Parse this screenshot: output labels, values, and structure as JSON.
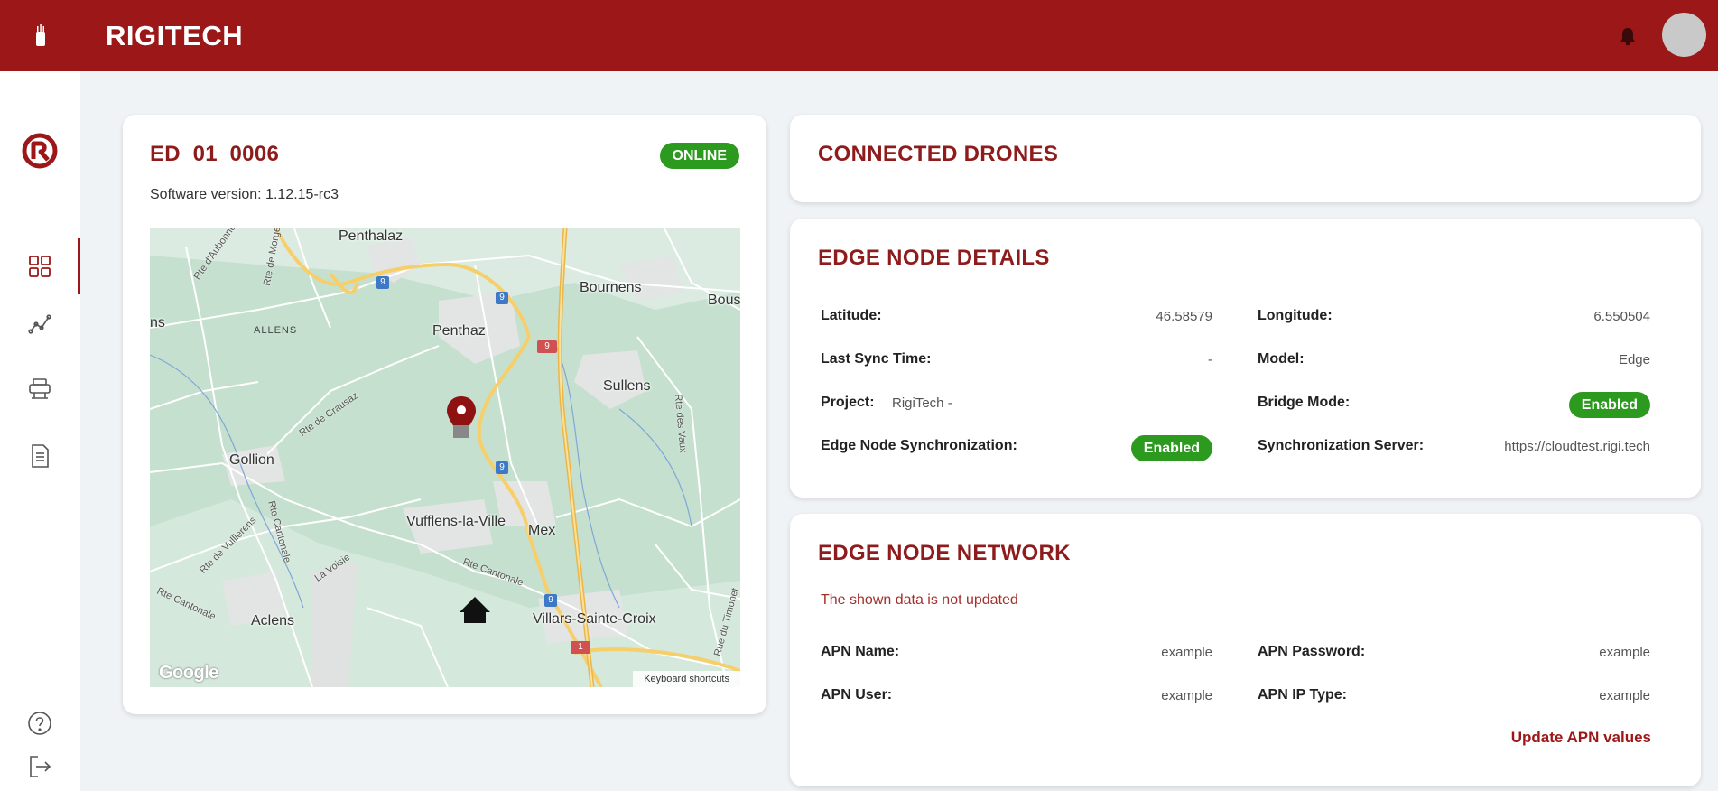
{
  "header": {
    "brand": "RIGITECH",
    "icons": [
      "rigitech-mark-icon",
      "bell-icon",
      "avatar"
    ]
  },
  "sidebar": {
    "items": [
      {
        "icon": "dashboard-grid-icon",
        "active": true
      },
      {
        "icon": "analytics-icon",
        "active": false
      },
      {
        "icon": "device-icon",
        "active": false
      },
      {
        "icon": "document-icon",
        "active": false
      },
      {
        "icon": "help-icon",
        "active": false
      },
      {
        "icon": "logout-icon",
        "active": false
      }
    ]
  },
  "node_card": {
    "title": "ED_01_0006",
    "status": "ONLINE",
    "software_version": "Software version: 1.12.15-rc3",
    "map": {
      "places": [
        "Penthalaz",
        "Bournens",
        "Bous",
        "ns",
        "Penthaz",
        "Sullens",
        "Gollion",
        "Vufflens-la-Ville",
        "Mex",
        "Aclens",
        "Villars-Sainte-Croix"
      ],
      "areas": [
        "ALLENS"
      ],
      "roads": [
        "Rte d'Aubonne",
        "Rte de Morges",
        "Rte de Crausaz",
        "Rte des Vaux",
        "Rte Cantonale",
        "Rte de Vullierens",
        "La Voisie",
        "Rte Cantonale",
        "Rte Cantonale",
        "Rue du Timonet"
      ],
      "road_numbers": [
        "9",
        "9",
        "9",
        "9",
        "9",
        "1"
      ],
      "attribution": "Google",
      "shortcuts": "Keyboard shortcuts"
    }
  },
  "drones_card": {
    "title": "CONNECTED DRONES"
  },
  "details_card": {
    "title": "EDGE NODE DETAILS",
    "latitude_label": "Latitude:",
    "latitude": "46.58579",
    "longitude_label": "Longitude:",
    "longitude": "6.550504",
    "last_sync_label": "Last Sync Time:",
    "last_sync": "-",
    "model_label": "Model:",
    "model": "Edge",
    "project_label": "Project:",
    "project": "RigiTech -",
    "bridge_label": "Bridge Mode:",
    "bridge": "Enabled",
    "sync_label": "Edge Node Synchronization:",
    "sync": "Enabled",
    "server_label": "Synchronization Server:",
    "server": "https://cloudtest.rigi.tech"
  },
  "network_card": {
    "title": "EDGE NODE NETWORK",
    "warning": "The shown data is not updated",
    "apn_name_label": "APN Name:",
    "apn_name": "example",
    "apn_password_label": "APN Password:",
    "apn_password": "example",
    "apn_user_label": "APN User:",
    "apn_user": "example",
    "apn_ip_label": "APN IP Type:",
    "apn_ip": "example",
    "update_button": "Update APN values"
  },
  "colors": {
    "brand": "#9c1717",
    "title": "#8f1c1c",
    "success": "#2c9a1e",
    "background": "#f0f3f6"
  }
}
